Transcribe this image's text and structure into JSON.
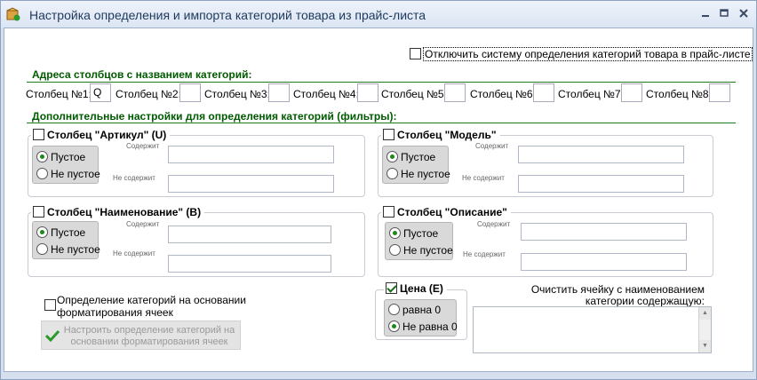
{
  "window": {
    "title": "Настройка определения и импорта категорий товара из прайс-листа",
    "controls": [
      "minimize-icon",
      "restore-icon",
      "close-icon"
    ]
  },
  "disable_system": {
    "label": "Отключить систему определения категорий товара в прайс-листе",
    "checked": false
  },
  "addresses": {
    "heading": "Адреса столбцов с названием категорий:",
    "columns": [
      {
        "label": "Столбец №1:",
        "value": "Q"
      },
      {
        "label": "Столбец №2:",
        "value": ""
      },
      {
        "label": "Столбец №3:",
        "value": ""
      },
      {
        "label": "Столбец №4:",
        "value": ""
      },
      {
        "label": "Столбец №5:",
        "value": ""
      },
      {
        "label": "Столбец №6:",
        "value": ""
      },
      {
        "label": "Столбец №7:",
        "value": ""
      },
      {
        "label": "Столбец №8:",
        "value": ""
      }
    ]
  },
  "filters": {
    "heading": "Дополнительные настройки для определения категорий (фильтры):",
    "groups": [
      {
        "title": "Столбец \"Артикул\" (U)",
        "checked": false,
        "opt_empty": "Пустое",
        "opt_not_empty": "Не пустое",
        "selected": "empty",
        "contains_label": "Содержит",
        "not_contains_label": "Не содержит",
        "contains_value": "",
        "not_contains_value": ""
      },
      {
        "title": "Столбец \"Модель\"",
        "checked": false,
        "opt_empty": "Пустое",
        "opt_not_empty": "Не пустое",
        "selected": "empty",
        "contains_label": "Содержит",
        "not_contains_label": "Не содержит",
        "contains_value": "",
        "not_contains_value": ""
      },
      {
        "title": "Столбец \"Наименование\" (B)",
        "checked": false,
        "opt_empty": "Пустое",
        "opt_not_empty": "Не пустое",
        "selected": "empty",
        "contains_label": "Содержит",
        "not_contains_label": "Не содержит",
        "contains_value": "",
        "not_contains_value": ""
      },
      {
        "title": "Столбец \"Описание\"",
        "checked": false,
        "opt_empty": "Пустое",
        "opt_not_empty": "Не пустое",
        "selected": "empty",
        "contains_label": "Содержит",
        "not_contains_label": "Не содержит",
        "contains_value": "",
        "not_contains_value": ""
      }
    ]
  },
  "format_detection": {
    "label_line1": "Определение категорий на основании",
    "label_line2": "форматирования ячеек",
    "checked": false,
    "button_line1": "Настроить определение категорий на",
    "button_line2": "основании форматирования ячеек"
  },
  "price": {
    "title": "Цена (E)",
    "checked": true,
    "opt_zero": "равна 0",
    "opt_not_zero": "Не равна 0",
    "selected": "not_zero"
  },
  "clear_cell": {
    "label_line1": "Очистить ячейку с наименованием",
    "label_line2": "категории содержащую:",
    "value": ""
  }
}
